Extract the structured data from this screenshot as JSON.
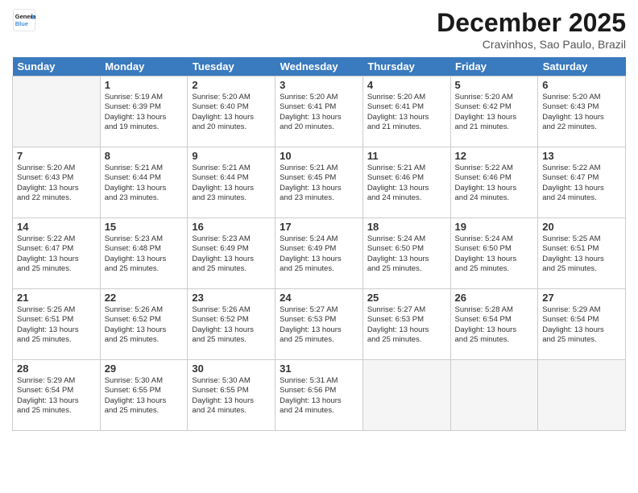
{
  "header": {
    "logo_line1": "General",
    "logo_line2": "Blue",
    "month": "December 2025",
    "location": "Cravinhos, Sao Paulo, Brazil"
  },
  "weekdays": [
    "Sunday",
    "Monday",
    "Tuesday",
    "Wednesday",
    "Thursday",
    "Friday",
    "Saturday"
  ],
  "weeks": [
    [
      {
        "day": "",
        "info": ""
      },
      {
        "day": "1",
        "info": "Sunrise: 5:19 AM\nSunset: 6:39 PM\nDaylight: 13 hours\nand 19 minutes."
      },
      {
        "day": "2",
        "info": "Sunrise: 5:20 AM\nSunset: 6:40 PM\nDaylight: 13 hours\nand 20 minutes."
      },
      {
        "day": "3",
        "info": "Sunrise: 5:20 AM\nSunset: 6:41 PM\nDaylight: 13 hours\nand 20 minutes."
      },
      {
        "day": "4",
        "info": "Sunrise: 5:20 AM\nSunset: 6:41 PM\nDaylight: 13 hours\nand 21 minutes."
      },
      {
        "day": "5",
        "info": "Sunrise: 5:20 AM\nSunset: 6:42 PM\nDaylight: 13 hours\nand 21 minutes."
      },
      {
        "day": "6",
        "info": "Sunrise: 5:20 AM\nSunset: 6:43 PM\nDaylight: 13 hours\nand 22 minutes."
      }
    ],
    [
      {
        "day": "7",
        "info": "Sunrise: 5:20 AM\nSunset: 6:43 PM\nDaylight: 13 hours\nand 22 minutes."
      },
      {
        "day": "8",
        "info": "Sunrise: 5:21 AM\nSunset: 6:44 PM\nDaylight: 13 hours\nand 23 minutes."
      },
      {
        "day": "9",
        "info": "Sunrise: 5:21 AM\nSunset: 6:44 PM\nDaylight: 13 hours\nand 23 minutes."
      },
      {
        "day": "10",
        "info": "Sunrise: 5:21 AM\nSunset: 6:45 PM\nDaylight: 13 hours\nand 23 minutes."
      },
      {
        "day": "11",
        "info": "Sunrise: 5:21 AM\nSunset: 6:46 PM\nDaylight: 13 hours\nand 24 minutes."
      },
      {
        "day": "12",
        "info": "Sunrise: 5:22 AM\nSunset: 6:46 PM\nDaylight: 13 hours\nand 24 minutes."
      },
      {
        "day": "13",
        "info": "Sunrise: 5:22 AM\nSunset: 6:47 PM\nDaylight: 13 hours\nand 24 minutes."
      }
    ],
    [
      {
        "day": "14",
        "info": "Sunrise: 5:22 AM\nSunset: 6:47 PM\nDaylight: 13 hours\nand 25 minutes."
      },
      {
        "day": "15",
        "info": "Sunrise: 5:23 AM\nSunset: 6:48 PM\nDaylight: 13 hours\nand 25 minutes."
      },
      {
        "day": "16",
        "info": "Sunrise: 5:23 AM\nSunset: 6:49 PM\nDaylight: 13 hours\nand 25 minutes."
      },
      {
        "day": "17",
        "info": "Sunrise: 5:24 AM\nSunset: 6:49 PM\nDaylight: 13 hours\nand 25 minutes."
      },
      {
        "day": "18",
        "info": "Sunrise: 5:24 AM\nSunset: 6:50 PM\nDaylight: 13 hours\nand 25 minutes."
      },
      {
        "day": "19",
        "info": "Sunrise: 5:24 AM\nSunset: 6:50 PM\nDaylight: 13 hours\nand 25 minutes."
      },
      {
        "day": "20",
        "info": "Sunrise: 5:25 AM\nSunset: 6:51 PM\nDaylight: 13 hours\nand 25 minutes."
      }
    ],
    [
      {
        "day": "21",
        "info": "Sunrise: 5:25 AM\nSunset: 6:51 PM\nDaylight: 13 hours\nand 25 minutes."
      },
      {
        "day": "22",
        "info": "Sunrise: 5:26 AM\nSunset: 6:52 PM\nDaylight: 13 hours\nand 25 minutes."
      },
      {
        "day": "23",
        "info": "Sunrise: 5:26 AM\nSunset: 6:52 PM\nDaylight: 13 hours\nand 25 minutes."
      },
      {
        "day": "24",
        "info": "Sunrise: 5:27 AM\nSunset: 6:53 PM\nDaylight: 13 hours\nand 25 minutes."
      },
      {
        "day": "25",
        "info": "Sunrise: 5:27 AM\nSunset: 6:53 PM\nDaylight: 13 hours\nand 25 minutes."
      },
      {
        "day": "26",
        "info": "Sunrise: 5:28 AM\nSunset: 6:54 PM\nDaylight: 13 hours\nand 25 minutes."
      },
      {
        "day": "27",
        "info": "Sunrise: 5:29 AM\nSunset: 6:54 PM\nDaylight: 13 hours\nand 25 minutes."
      }
    ],
    [
      {
        "day": "28",
        "info": "Sunrise: 5:29 AM\nSunset: 6:54 PM\nDaylight: 13 hours\nand 25 minutes."
      },
      {
        "day": "29",
        "info": "Sunrise: 5:30 AM\nSunset: 6:55 PM\nDaylight: 13 hours\nand 25 minutes."
      },
      {
        "day": "30",
        "info": "Sunrise: 5:30 AM\nSunset: 6:55 PM\nDaylight: 13 hours\nand 24 minutes."
      },
      {
        "day": "31",
        "info": "Sunrise: 5:31 AM\nSunset: 6:56 PM\nDaylight: 13 hours\nand 24 minutes."
      },
      {
        "day": "",
        "info": ""
      },
      {
        "day": "",
        "info": ""
      },
      {
        "day": "",
        "info": ""
      }
    ]
  ]
}
